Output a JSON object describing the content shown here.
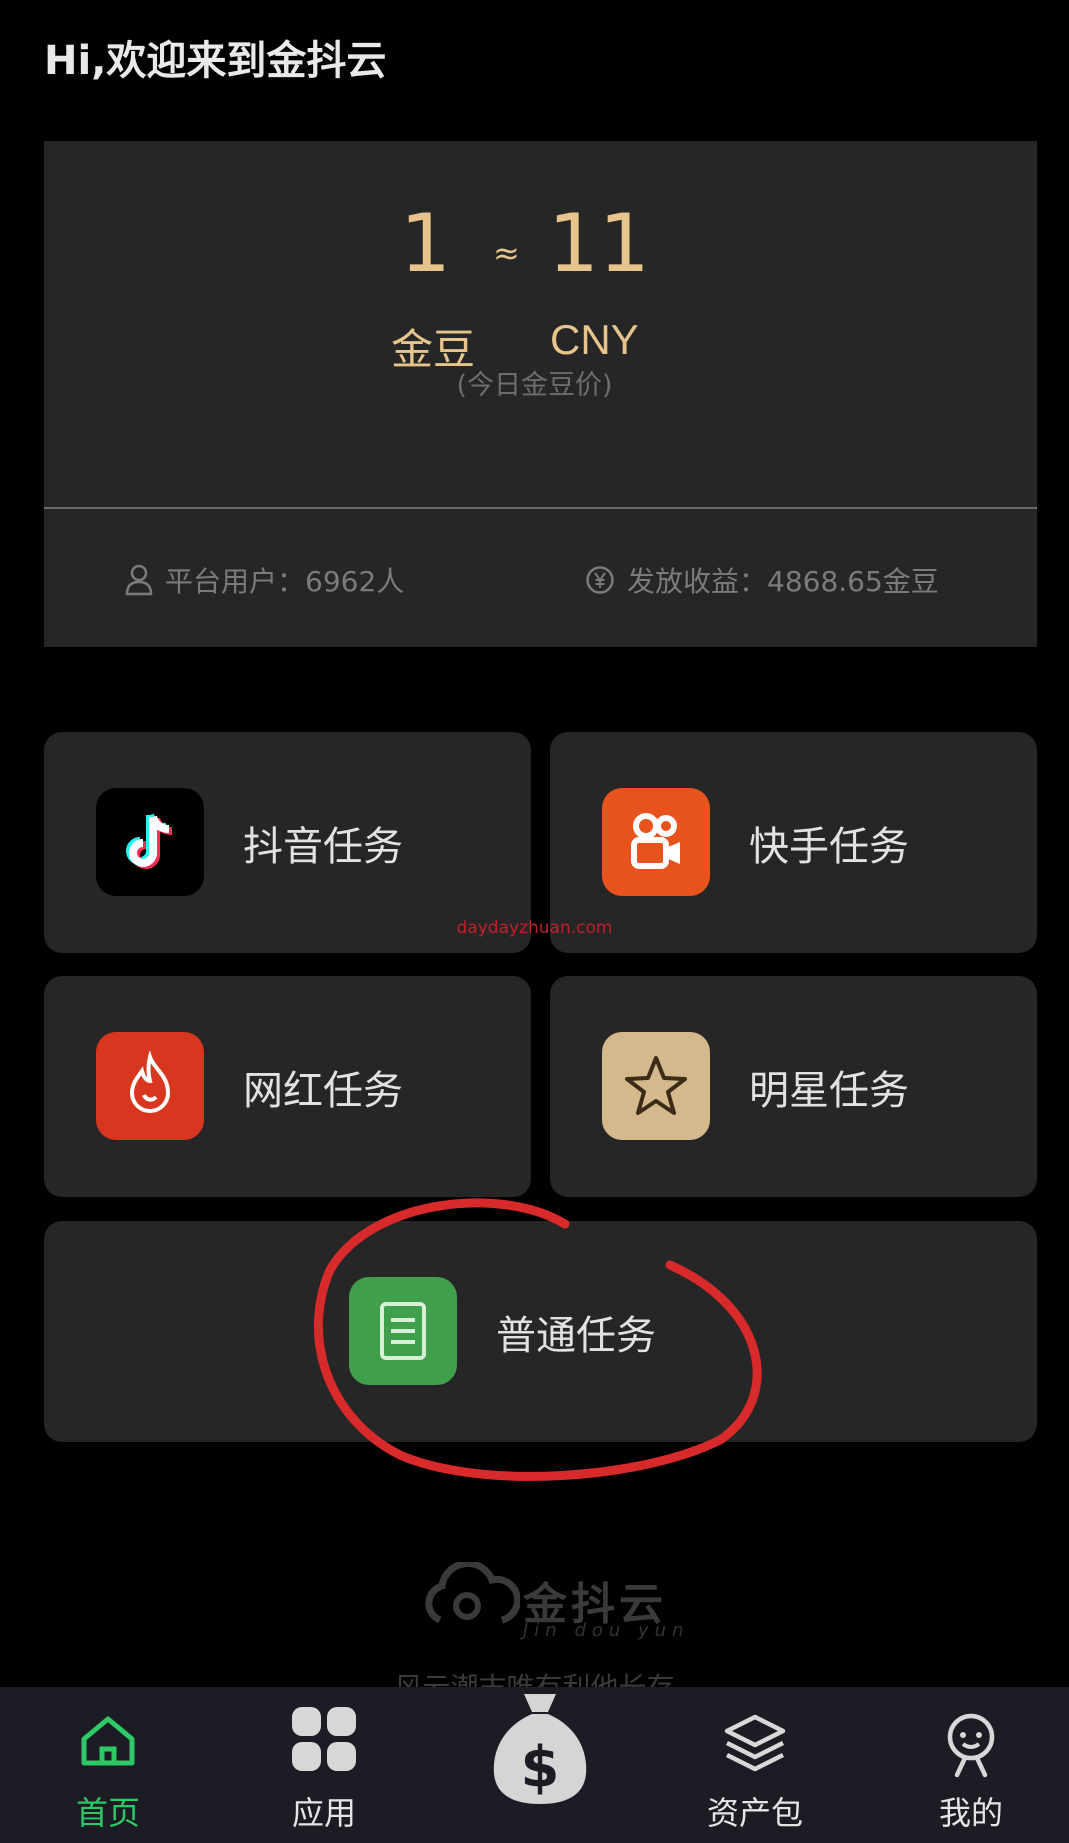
{
  "header": {
    "greeting": "Hi,欢迎来到金抖云"
  },
  "rate_card": {
    "left_value": "1",
    "approx_symbol": "≈",
    "right_value": "11",
    "left_unit": "金豆",
    "right_unit": "CNY",
    "note": "(今日金豆价)",
    "stats": {
      "users_label": "平台用户：6962人",
      "earnings_label": "发放收益：4868.65金豆"
    }
  },
  "tasks": [
    {
      "label": "抖音任务",
      "icon": "douyin-icon",
      "color": "#000000"
    },
    {
      "label": "快手任务",
      "icon": "kuaishou-icon",
      "color": "#e8521c"
    },
    {
      "label": "网红任务",
      "icon": "flame-icon",
      "color": "#d8361f"
    },
    {
      "label": "明星任务",
      "icon": "star-icon",
      "color": "#d3b98b"
    },
    {
      "label": "普通任务",
      "icon": "document-icon",
      "color": "#3f9f4a"
    }
  ],
  "watermark": "daydayzhuan.com",
  "footer": {
    "logo_text": "金抖云",
    "logo_sub": "Jin dou yun",
    "slogan": "风云潮末唯有利他长存"
  },
  "tabbar": {
    "items": [
      {
        "label": "首页",
        "icon": "home-icon",
        "active": true
      },
      {
        "label": "应用",
        "icon": "apps-icon",
        "active": false
      },
      {
        "label": "",
        "icon": "money-bag-icon",
        "active": false
      },
      {
        "label": "资产包",
        "icon": "layers-icon",
        "active": false
      },
      {
        "label": "我的",
        "icon": "profile-icon",
        "active": false
      }
    ],
    "active_color": "#2ec866"
  },
  "colors": {
    "gold": "#e6c48c",
    "card_bg": "#262626",
    "annotation_red": "#d82a2a"
  }
}
